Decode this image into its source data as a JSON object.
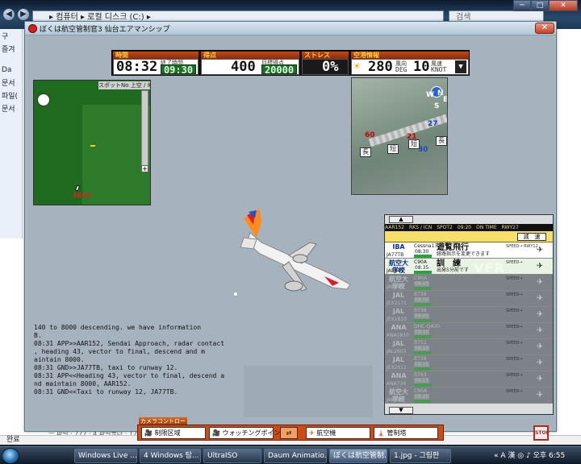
{
  "explorer": {
    "breadcrumb": "▸ 컴퓨터 ▸ 로컬 디스크 (C:) ▸",
    "search_placeholder": "검색",
    "window_buttons": [
      "─",
      "□",
      "✕"
    ],
    "left_pane_items": [
      "구",
      "즐겨",
      "Da",
      "문서",
      "파일(",
      "문서"
    ],
    "status_text": "완료",
    "row_strip": "ㅡ 파일 · 777 · 4 파일폴더 · 12 · 파일 · 0 · 0 · 0 · 25 · 09:30"
  },
  "game": {
    "title": "ぼくは航空管制官3 仙台エアマンシップ",
    "close_label": "✕",
    "hud": {
      "time_label": "時間",
      "time": "08:32",
      "end_time_label": "終了時間",
      "end_time": "09:30",
      "score_label": "得点",
      "score": "400",
      "target_score_label": "目標得点",
      "target_score": "20000",
      "stress_label": "ストレス",
      "stress": "0%",
      "weather_label": "空港情報",
      "wind_dir": "280",
      "wind_dir_unit_jp": "風向",
      "wind_dir_unit": "DEG",
      "wind_speed": "10",
      "wind_speed_unit_jp": "風速",
      "wind_speed_unit": "KNOT",
      "dropdown": "▼"
    },
    "minimap": {
      "spot_label": "スポットNo",
      "updown_label": "上空 / 地上",
      "zoom_plus": "+",
      "marker": "5654"
    },
    "satellite": {
      "labels": [
        "60",
        "21",
        "27",
        "30",
        "N",
        "W",
        "E",
        "S"
      ],
      "tags": [
        "長",
        "短",
        "短",
        "長"
      ]
    },
    "strips": {
      "up_arrow": "▲",
      "down_arrow": "▼",
      "header": "AAR152　RKS / ICN　SPOT2　09:20　ON TIME　RWY27",
      "yellow_button": "減　速",
      "rows": [
        {
          "logo": "IBA",
          "callsign": "JA77TB",
          "type": "Cessna172",
          "time": "08:30",
          "instr": "遊覧飛行",
          "note": "経路指示を変更できます",
          "spd": "SPEED→ RWY12",
          "vfr": "VFR",
          "icon": "✈",
          "dim": false
        },
        {
          "logo": "航空大学校",
          "callsign": "JA8847",
          "type": "C90A",
          "time": "08:35",
          "instr": "訓　練",
          "note": "出発5分前です",
          "spd": "SPEED→",
          "vfr": "VFR",
          "icon": "✈",
          "dim": false
        },
        {
          "logo": "航空大学校",
          "callsign": "JA8853",
          "type": "C90A",
          "time": "09:00",
          "instr": "",
          "note": "",
          "spd": "SPEED→",
          "vfr": "",
          "icon": "✈",
          "dim": true
        },
        {
          "logo": "JAL",
          "callsign": "JEX2171",
          "type": "B738",
          "time": "09:00",
          "instr": "",
          "note": "",
          "spd": "SPEED→",
          "vfr": "",
          "icon": "✈",
          "dim": true
        },
        {
          "logo": "JAL",
          "callsign": "JEX1810",
          "type": "B738",
          "time": "09:05",
          "instr": "",
          "note": "",
          "spd": "SPEED→",
          "vfr": "",
          "icon": "✈",
          "dim": true
        },
        {
          "logo": "ANA",
          "callsign": "ANA1810",
          "type": "DHC-Q400",
          "time": "09:10",
          "instr": "",
          "note": "",
          "spd": "SPEED→",
          "vfr": "",
          "icon": "✈",
          "dim": true
        },
        {
          "logo": "JAL",
          "callsign": "JAL2903",
          "type": "B752",
          "time": "09:10",
          "instr": "",
          "note": "",
          "spd": "SPEED→",
          "vfr": "",
          "icon": "✈",
          "dim": true
        },
        {
          "logo": "JAL",
          "callsign": "JEX2011",
          "type": "B738",
          "time": "09:15",
          "instr": "",
          "note": "",
          "spd": "SPEED→",
          "vfr": "",
          "icon": "✈",
          "dim": true
        },
        {
          "logo": "ANA",
          "callsign": "ANA734",
          "type": "B763",
          "time": "09:15",
          "instr": "",
          "note": "",
          "spd": "SPEED→",
          "vfr": "",
          "icon": "✈",
          "dim": true
        },
        {
          "logo": "航空大学校",
          "callsign": "JA8850",
          "type": "C90A",
          "time": "09:20",
          "instr": "",
          "note": "",
          "spd": "SPEED→",
          "vfr": "",
          "icon": "✈",
          "dim": true
        }
      ]
    },
    "radio_log": [
      "140 to 8000 descending. we have information",
      " B.",
      "08:31 APP>>AAR152, Sendai Approach, radar contact",
      " , heading 43, vector to final, descend and m",
      " aintain 8000.",
      "08:31 GND>>JA77TB, taxi to runway 12.",
      "08:31 APP<<Heading 43, vector to final, descend a",
      " nd maintain 8000, AAR152.",
      "08:31 GND<<Taxi to runway 12, JA77TB."
    ],
    "camera": {
      "label": "カメラコントロール",
      "buttons": [
        "制限区域",
        "ウォッチングポイント",
        "",
        "航空機",
        "管制塔"
      ],
      "stop": "STOP"
    }
  },
  "taskbar": {
    "items": [
      "Windows Live ...",
      "4 Windows 탐...",
      "UltraISO",
      "Daum Animatio...",
      "ぼくは航空管制...",
      "1.jpg - 그림판"
    ],
    "active_index": 4,
    "tray": "« A 漢 ◎ ♪ 오후 6:55"
  },
  "colors": {
    "game_bg": "#a6b3be",
    "hud_label": "#ffcc33",
    "camera_bar": "#d24a12",
    "strip_yellow": "#f6df6a"
  }
}
